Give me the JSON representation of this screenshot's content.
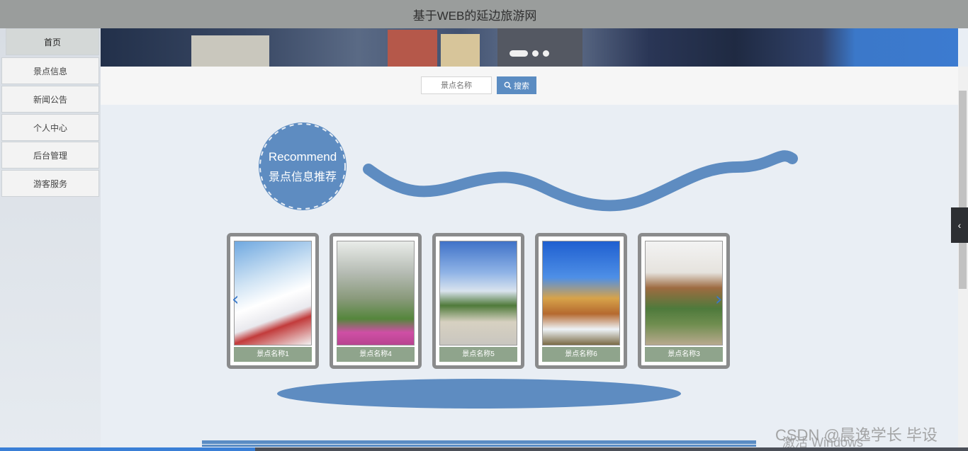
{
  "header": {
    "title": "基于WEB的延边旅游网"
  },
  "sidebar": {
    "items": [
      {
        "label": "首页",
        "active": true
      },
      {
        "label": "景点信息"
      },
      {
        "label": "新闻公告"
      },
      {
        "label": "个人中心"
      },
      {
        "label": "后台管理"
      },
      {
        "label": "游客服务"
      }
    ]
  },
  "search": {
    "placeholder": "景点名称",
    "button_label": "搜索"
  },
  "recommend": {
    "title_en": "Recommend",
    "title_zh": "景点信息推荐"
  },
  "cards": [
    {
      "caption": "景点名称1"
    },
    {
      "caption": "景点名称4"
    },
    {
      "caption": "景点名称5"
    },
    {
      "caption": "景点名称6"
    },
    {
      "caption": "景点名称3"
    }
  ],
  "carousel": {
    "prev_icon": "‹",
    "next_icon": "›"
  },
  "side_toggle": {
    "icon": "‹"
  },
  "watermark": {
    "text": "CSDN @晨逸学长 毕设",
    "text2": "激活 Windows"
  },
  "colors": {
    "accent": "#5b8cc2",
    "topbar": "#9a9d9c",
    "caption_bg": "#8fa48c"
  }
}
